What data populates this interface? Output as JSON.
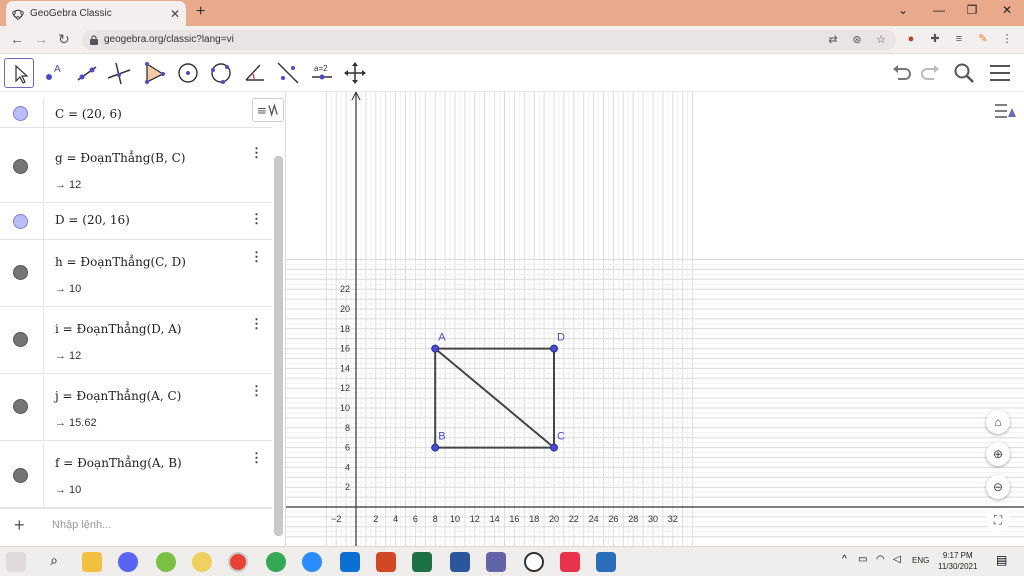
{
  "browser": {
    "tab_title": "GeoGebra Classic",
    "url": "geogebra.org/classic?lang=vi",
    "tab_close": "✕",
    "new_tab": "+",
    "win_min": "⌄",
    "win_min2": "—",
    "win_max": "❐",
    "win_close": "✕"
  },
  "algebra": {
    "items": [
      {
        "def": "C = (20, 6)",
        "val": "",
        "color": "point"
      },
      {
        "def": "g = ĐoạnThẳng(B, C)",
        "val": "→ 12",
        "color": "segment"
      },
      {
        "def": "D = (20, 16)",
        "val": "",
        "color": "point"
      },
      {
        "def": "h = ĐoạnThẳng(C, D)",
        "val": "→ 10",
        "color": "segment"
      },
      {
        "def": "i = ĐoạnThẳng(D, A)",
        "val": "→ 12",
        "color": "segment"
      },
      {
        "def": "j = ĐoạnThẳng(A, C)",
        "val": "→ 15.62",
        "color": "segment"
      },
      {
        "def": "f = ĐoạnThẳng(A, B)",
        "val": "→ 10",
        "color": "segment"
      }
    ],
    "menu_glyph": "⋮",
    "input_placeholder": "Nhập lệnh...",
    "add_glyph": "+"
  },
  "graphics": {
    "x_ticks": [
      "−2",
      "2",
      "4",
      "6",
      "8",
      "10",
      "12",
      "14",
      "16",
      "18",
      "20",
      "22",
      "24",
      "26",
      "28",
      "30",
      "32"
    ],
    "y_ticks": [
      "2",
      "4",
      "6",
      "8",
      "10",
      "12",
      "14",
      "16",
      "18",
      "20",
      "22"
    ],
    "points": [
      {
        "name": "A",
        "x": 8,
        "y": 16
      },
      {
        "name": "B",
        "x": 8,
        "y": 6
      },
      {
        "name": "C",
        "x": 20,
        "y": 6
      },
      {
        "name": "D",
        "x": 20,
        "y": 16
      }
    ],
    "segments": [
      [
        "A",
        "B"
      ],
      [
        "B",
        "C"
      ],
      [
        "C",
        "D"
      ],
      [
        "D",
        "A"
      ],
      [
        "A",
        "C"
      ]
    ],
    "point_color": "#4a4acf",
    "segment_color": "#444444"
  },
  "taskbar": {
    "lang": "ENG",
    "time": "9:17 PM",
    "date": "11/30/2021"
  }
}
